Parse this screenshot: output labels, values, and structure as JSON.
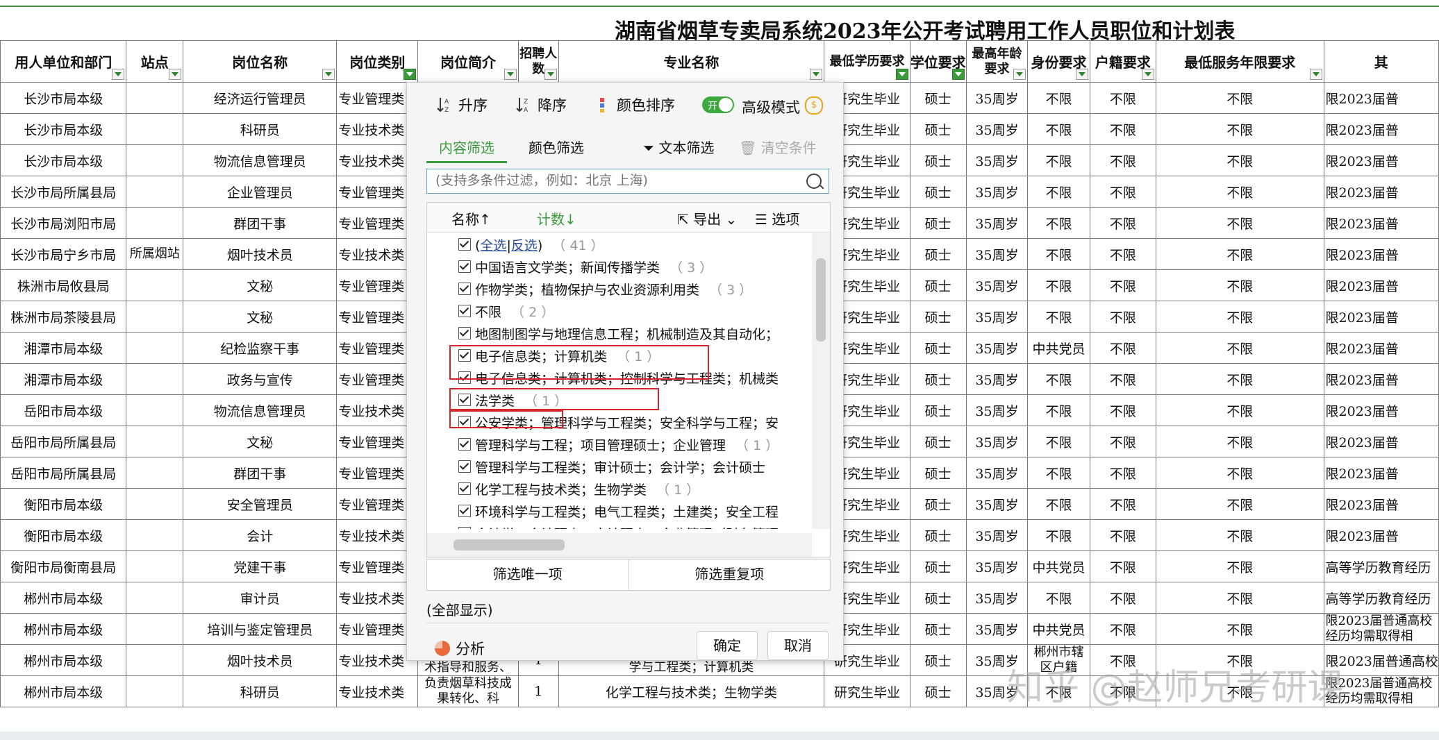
{
  "title": "湖南省烟草专卖局系统2023年公开考试聘用工作人员职位和计划表",
  "headers": [
    "用人单位和部门",
    "站点",
    "岗位名称",
    "岗位类别",
    "岗位简介",
    "招聘人数",
    "专业名称",
    "最低学历要求",
    "学位要求",
    "最高年龄要求",
    "身份要求",
    "户籍要求",
    "最低服务年限要求",
    "其"
  ],
  "rows": [
    [
      "长沙市局本级",
      "",
      "经济运行管理员",
      "专业管理类",
      "",
      "",
      "",
      "研究生毕业",
      "硕士",
      "35周岁",
      "不限",
      "不限",
      "不限",
      "限2023届普"
    ],
    [
      "长沙市局本级",
      "",
      "科研员",
      "专业技术类",
      "",
      "",
      "",
      "研究生毕业",
      "硕士",
      "35周岁",
      "不限",
      "不限",
      "不限",
      "限2023届普"
    ],
    [
      "长沙市局本级",
      "",
      "物流信息管理员",
      "专业技术类",
      "",
      "",
      "",
      "研究生毕业",
      "硕士",
      "35周岁",
      "不限",
      "不限",
      "不限",
      "限2023届普"
    ],
    [
      "长沙市局所属县局",
      "",
      "企业管理员",
      "专业管理类",
      "",
      "",
      "",
      "研究生毕业",
      "硕士",
      "35周岁",
      "不限",
      "不限",
      "不限",
      "限2023届普"
    ],
    [
      "长沙市局浏阳市局",
      "",
      "群团干事",
      "专业管理类",
      "",
      "",
      "",
      "研究生毕业",
      "硕士",
      "35周岁",
      "不限",
      "不限",
      "不限",
      "限2023届普"
    ],
    [
      "长沙市局宁乡市局",
      "所属烟站",
      "烟叶技术员",
      "专业技术类",
      "",
      "",
      "",
      "研究生毕业",
      "硕士",
      "35周岁",
      "不限",
      "不限",
      "不限",
      "限2023届普"
    ],
    [
      "株洲市局攸县局",
      "",
      "文秘",
      "专业管理类",
      "",
      "",
      "",
      "研究生毕业",
      "硕士",
      "35周岁",
      "不限",
      "不限",
      "不限",
      "限2023届普"
    ],
    [
      "株洲市局茶陵县局",
      "",
      "文秘",
      "专业管理类",
      "",
      "",
      "",
      "研究生毕业",
      "硕士",
      "35周岁",
      "不限",
      "不限",
      "不限",
      "限2023届普"
    ],
    [
      "湘潭市局本级",
      "",
      "纪检监察干事",
      "专业管理类",
      "",
      "",
      "",
      "研究生毕业",
      "硕士",
      "35周岁",
      "中共党员",
      "不限",
      "不限",
      "限2023届普"
    ],
    [
      "湘潭市局本级",
      "",
      "政务与宣传",
      "专业管理类",
      "",
      "",
      "",
      "研究生毕业",
      "硕士",
      "35周岁",
      "不限",
      "不限",
      "不限",
      "限2023届普"
    ],
    [
      "岳阳市局本级",
      "",
      "物流信息管理员",
      "专业技术类",
      "",
      "",
      "",
      "研究生毕业",
      "硕士",
      "35周岁",
      "不限",
      "不限",
      "不限",
      "限2023届普"
    ],
    [
      "岳阳市局所属县局",
      "",
      "文秘",
      "专业管理类",
      "",
      "",
      "",
      "研究生毕业",
      "硕士",
      "35周岁",
      "不限",
      "不限",
      "不限",
      "限2023届普"
    ],
    [
      "岳阳市局所属县局",
      "",
      "群团干事",
      "专业管理类",
      "",
      "",
      "",
      "研究生毕业",
      "硕士",
      "35周岁",
      "不限",
      "不限",
      "不限",
      "限2023届普"
    ],
    [
      "衡阳市局本级",
      "",
      "安全管理员",
      "专业管理类",
      "",
      "",
      "",
      "研究生毕业",
      "硕士",
      "35周岁",
      "不限",
      "不限",
      "不限",
      "限2023届普"
    ],
    [
      "衡阳市局本级",
      "",
      "会计",
      "专业技术类",
      "",
      "",
      "",
      "研究生毕业",
      "硕士",
      "35周岁",
      "不限",
      "不限",
      "不限",
      "限2023届普"
    ],
    [
      "衡阳市局衡南县局",
      "",
      "党建干事",
      "专业管理类",
      "",
      "",
      "",
      "研究生毕业",
      "硕士",
      "35周岁",
      "中共党员",
      "不限",
      "不限",
      "高等学历教育经历"
    ],
    [
      "郴州市局本级",
      "",
      "审计员",
      "专业技术类",
      "",
      "",
      "",
      "研究生毕业",
      "硕士",
      "35周岁",
      "不限",
      "不限",
      "不限",
      "高等学历教育经历"
    ],
    [
      "郴州市局本级",
      "",
      "培训与鉴定管理员",
      "专业管理类",
      "",
      "",
      "",
      "研究生毕业",
      "硕士",
      "35周岁",
      "中共党员",
      "不限",
      "不限",
      "限2023届普通高校经历均需取得相"
    ],
    [
      "郴州市局本级",
      "",
      "烟叶技术员",
      "专业技术类",
      "从事烟叶生产技术指导和服务、",
      "1",
      "作物学类；植物保护与农业资源利用类；管理科学与工程类；计算机类",
      "研究生毕业",
      "硕士",
      "35周岁",
      "郴州市辖区户籍",
      "不限",
      "不限",
      "限2023届普通高校"
    ],
    [
      "郴州市局本级",
      "",
      "科研员",
      "专业技术类",
      "负责烟草科技成果转化、科",
      "1",
      "化学工程与技术类；生物学类",
      "研究生毕业",
      "硕士",
      "35周岁",
      "不限",
      "不限",
      "不限",
      "限2023届普通高校经历均需取得相"
    ]
  ],
  "filter_popup": {
    "sort_asc": "升序",
    "sort_desc": "降序",
    "color_sort": "颜色排序",
    "toggle_label": "开",
    "advanced_mode": "高级模式",
    "tab_content": "内容筛选",
    "tab_color": "颜色筛选",
    "text_filter": "文本筛选",
    "clear_conditions": "清空条件",
    "search_placeholder": "(支持多条件过滤，例如：北京 上海)",
    "col_name": "名称↑",
    "col_count": "计数↓",
    "export": "导出",
    "options": "选项",
    "select_all": "全选",
    "invert": "反选",
    "select_all_count": "41",
    "items": [
      {
        "label": "中国语言文学类；新闻传播学类",
        "count": "3"
      },
      {
        "label": "作物学类；植物保护与农业资源利用类",
        "count": "3"
      },
      {
        "label": "不限",
        "count": "2"
      },
      {
        "label": "地图制图学与地理信息工程；机械制造及其自动化；",
        "count": ""
      },
      {
        "label": "电子信息类；计算机类",
        "count": "1"
      },
      {
        "label": "电子信息类；计算机类；控制科学与工程类；机械类",
        "count": ""
      },
      {
        "label": "法学类",
        "count": "1"
      },
      {
        "label": "公安学类；管理科学与工程类；安全科学与工程；安",
        "count": ""
      },
      {
        "label": "管理科学与工程；项目管理硕士；企业管理",
        "count": "1"
      },
      {
        "label": "管理科学与工程类；审计硕士；会计学；会计硕士",
        "count": ""
      },
      {
        "label": "化学工程与技术类；生物学类",
        "count": "1"
      },
      {
        "label": "环境科学与工程类；电气工程类；土建类；安全工程",
        "count": ""
      },
      {
        "label": "会计学；会计硕士；审计硕士；企业管理（财务管理",
        "count": ""
      }
    ],
    "unique_filter": "筛选唯一项",
    "duplicate_filter": "筛选重复项",
    "show_all": "(全部显示)",
    "analysis": "分析",
    "ok": "确定",
    "cancel": "取消"
  },
  "watermark": "知乎 @赵师兄考研课",
  "colors": {
    "accent": "#3a9a3a",
    "highlight_box": "#d8252c"
  }
}
